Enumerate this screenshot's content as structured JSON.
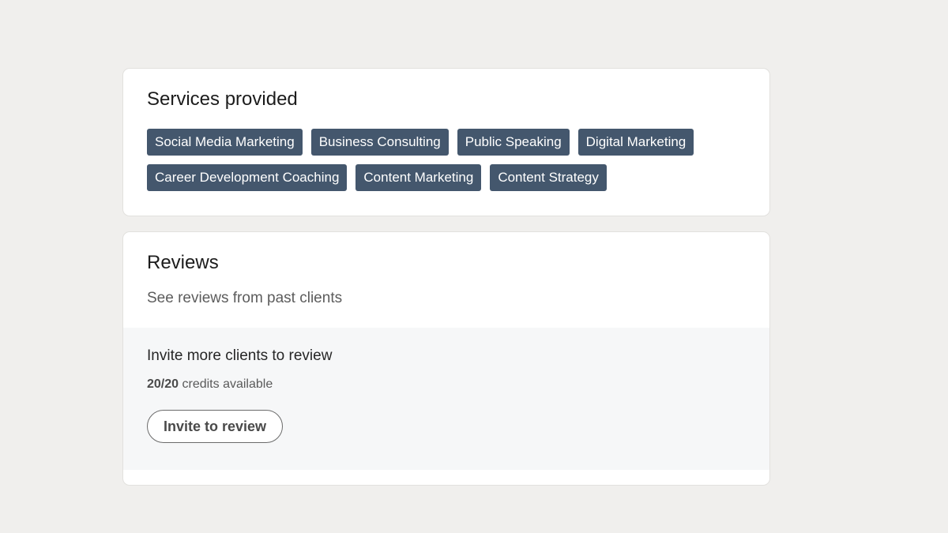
{
  "services": {
    "title": "Services provided",
    "tags": [
      "Social Media Marketing",
      "Business Consulting",
      "Public Speaking",
      "Digital Marketing",
      "Career Development Coaching",
      "Content Marketing",
      "Content Strategy"
    ]
  },
  "reviews": {
    "title": "Reviews",
    "subtitle": "See reviews from past clients",
    "invite": {
      "title": "Invite more clients to review",
      "credits_count": "20/20",
      "credits_label": "credits available",
      "button_label": "Invite to review"
    }
  },
  "colors": {
    "background": "#f0efed",
    "tag_background": "#44576d",
    "panel_background": "#f6f7f8"
  }
}
